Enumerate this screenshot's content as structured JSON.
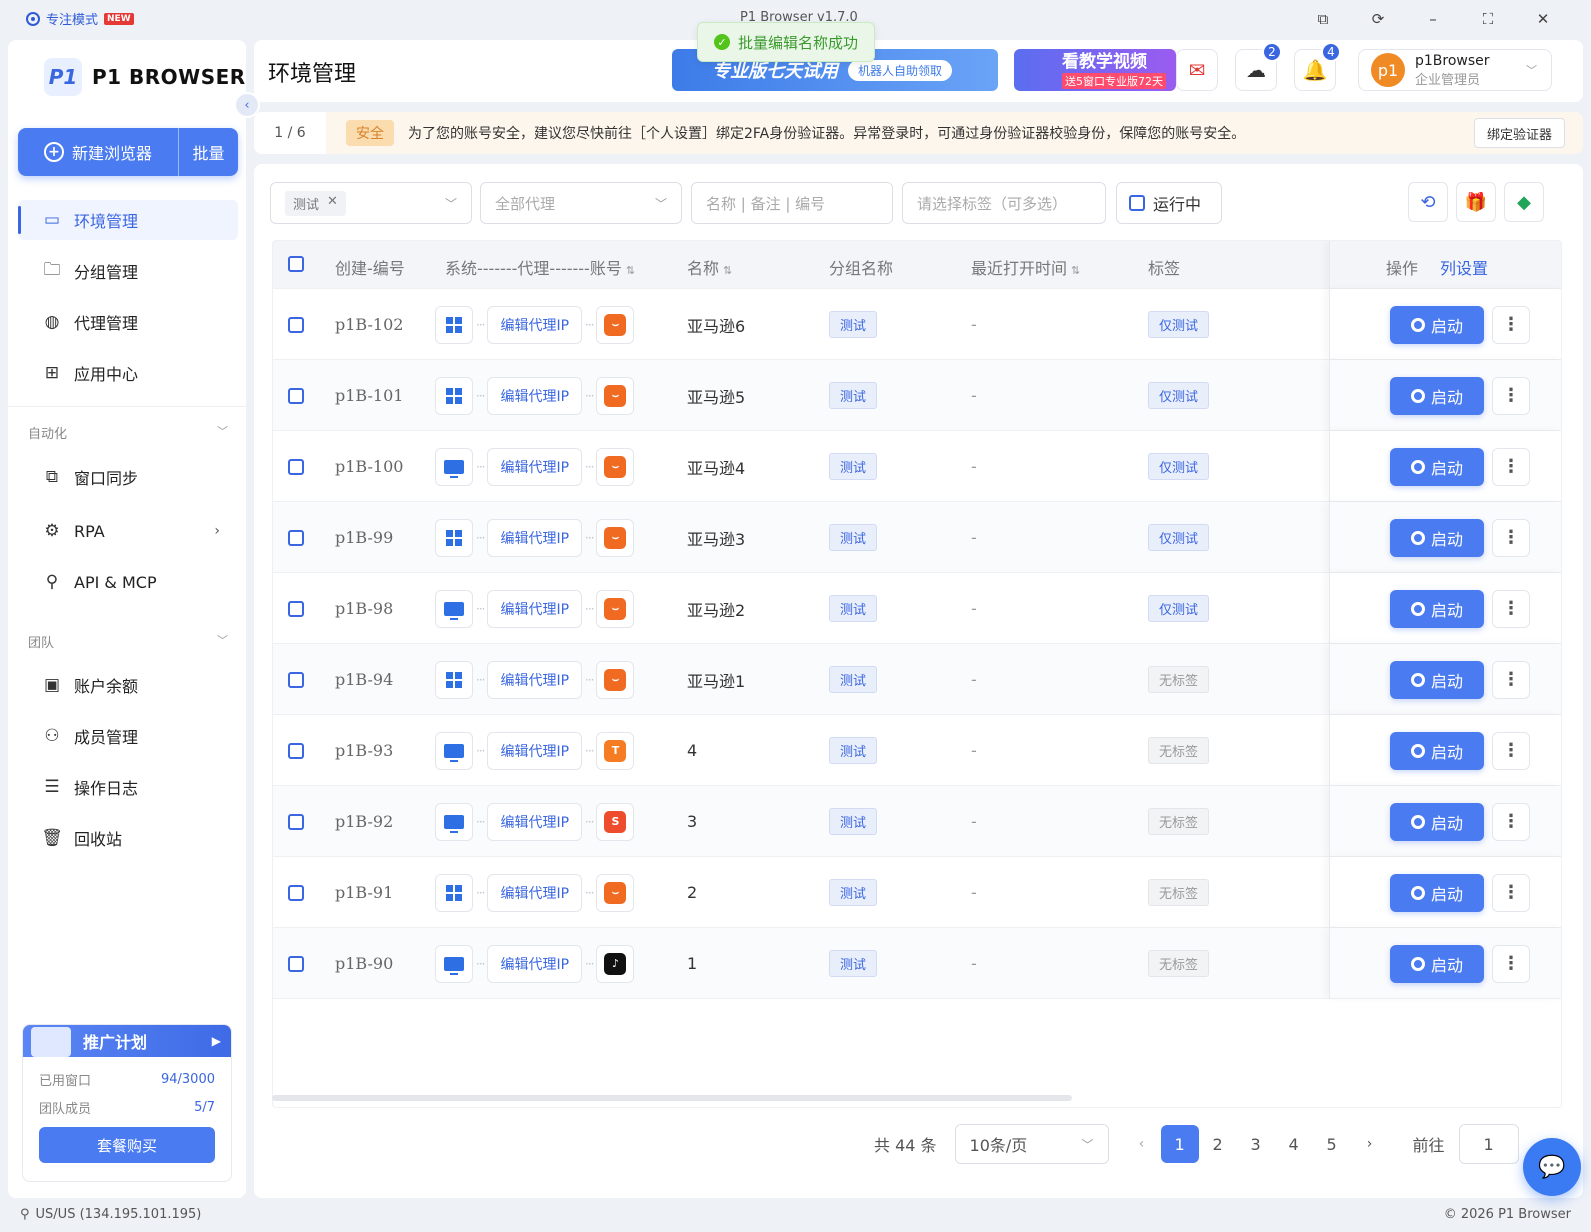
{
  "titlebar": {
    "focus_mode": "专注模式",
    "new_badge": "NEW",
    "app_title": "P1 Browser v1.7.0"
  },
  "toast": {
    "text": "批量编辑名称成功"
  },
  "sidebar": {
    "logo_mark": "P1",
    "logo_text": "P1 BROWSER",
    "new_browser": "新建浏览器",
    "batch": "批量",
    "nav_items": [
      {
        "label": "环境管理",
        "icon": "window-icon",
        "active": true
      },
      {
        "label": "分组管理",
        "icon": "folder-icon"
      },
      {
        "label": "代理管理",
        "icon": "globe-icon"
      },
      {
        "label": "应用中心",
        "icon": "apps-icon"
      }
    ],
    "section_automation": "自动化",
    "automation_items": [
      {
        "label": "窗口同步",
        "icon": "sync-icon"
      },
      {
        "label": "RPA",
        "icon": "robot-icon"
      },
      {
        "label": "API & MCP",
        "icon": "plug-icon"
      }
    ],
    "section_team": "团队",
    "team_items": [
      {
        "label": "账户余额",
        "icon": "wallet-icon"
      },
      {
        "label": "成员管理",
        "icon": "member-icon"
      },
      {
        "label": "操作日志",
        "icon": "log-icon"
      },
      {
        "label": "回收站",
        "icon": "trash-icon"
      }
    ],
    "promo": {
      "title": "推广计划",
      "used_windows_label": "已用窗口",
      "used_windows_value": "94/3000",
      "team_members_label": "团队成员",
      "team_members_value": "5/7",
      "buy_label": "套餐购买"
    }
  },
  "header": {
    "page_title": "环境管理",
    "banner1_text": "专业版七天试用",
    "banner1_chip": "机器人自助领取",
    "banner2_title": "看教学视频",
    "banner2_sub": "送5窗口专业版72天",
    "download_badge": "2",
    "bell_badge": "4",
    "user": {
      "avatar": "p1",
      "name": "p1Browser",
      "role": "企业管理员"
    }
  },
  "notice": {
    "pager": "1 / 6",
    "tag": "安全",
    "message": "为了您的账号安全，建议您尽快前往［个人设置］绑定2FA身份验证器。异常登录时，可通过身份验证器校验身份，保障您的账号安全。",
    "bind_button": "绑定验证器"
  },
  "filters": {
    "group_chip": "测试",
    "proxy_placeholder": "全部代理",
    "search_placeholder": "名称 | 备注 | 编号",
    "tag_placeholder": "请选择标签（可多选）",
    "running_label": "运行中"
  },
  "table": {
    "headers": {
      "id": "创建-编号",
      "sys": "系统-------代理-------账号",
      "name": "名称",
      "group": "分组名称",
      "last_open": "最近打开时间",
      "tags": "标签",
      "ops": "操作",
      "col_settings": "列设置"
    },
    "proxy_btn": "编辑代理IP",
    "start_btn": "启动",
    "rows": [
      {
        "id": "p1B-102",
        "os": "windows",
        "acct": "amazon",
        "name": "亚马逊6",
        "group": "测试",
        "last": "-",
        "tag": "仅测试",
        "tag_type": "test"
      },
      {
        "id": "p1B-101",
        "os": "windows",
        "acct": "amazon",
        "name": "亚马逊5",
        "group": "测试",
        "last": "-",
        "tag": "仅测试",
        "tag_type": "test"
      },
      {
        "id": "p1B-100",
        "os": "mac",
        "acct": "amazon",
        "name": "亚马逊4",
        "group": "测试",
        "last": "-",
        "tag": "仅测试",
        "tag_type": "test"
      },
      {
        "id": "p1B-99",
        "os": "windows",
        "acct": "amazon",
        "name": "亚马逊3",
        "group": "测试",
        "last": "-",
        "tag": "仅测试",
        "tag_type": "test"
      },
      {
        "id": "p1B-98",
        "os": "mac",
        "acct": "amazon",
        "name": "亚马逊2",
        "group": "测试",
        "last": "-",
        "tag": "仅测试",
        "tag_type": "test"
      },
      {
        "id": "p1B-94",
        "os": "windows",
        "acct": "amazon",
        "name": "亚马逊1",
        "group": "测试",
        "last": "-",
        "tag": "无标签",
        "tag_type": "none"
      },
      {
        "id": "p1B-93",
        "os": "mac",
        "acct": "temu",
        "name": "4",
        "group": "测试",
        "last": "-",
        "tag": "无标签",
        "tag_type": "none"
      },
      {
        "id": "p1B-92",
        "os": "mac",
        "acct": "shopee",
        "name": "3",
        "group": "测试",
        "last": "-",
        "tag": "无标签",
        "tag_type": "none"
      },
      {
        "id": "p1B-91",
        "os": "windows",
        "acct": "amazon",
        "name": "2",
        "group": "测试",
        "last": "-",
        "tag": "无标签",
        "tag_type": "none"
      },
      {
        "id": "p1B-90",
        "os": "mac",
        "acct": "tiktok",
        "name": "1",
        "group": "测试",
        "last": "-",
        "tag": "无标签",
        "tag_type": "none"
      }
    ]
  },
  "pagination": {
    "total": "共 44 条",
    "page_size": "10条/页",
    "pages": [
      "1",
      "2",
      "3",
      "4",
      "5"
    ],
    "current": "1",
    "goto_label": "前往",
    "goto_value": "1"
  },
  "footer": {
    "ip": "US/US (134.195.101.195)",
    "copyright": "© 2026 P1 Browser"
  },
  "colors": {
    "accent": "#4b7bf0",
    "amazon": "#f06a22",
    "temu": "#f57c22",
    "shopee": "#ee4d2d",
    "tiktok": "#111111"
  }
}
